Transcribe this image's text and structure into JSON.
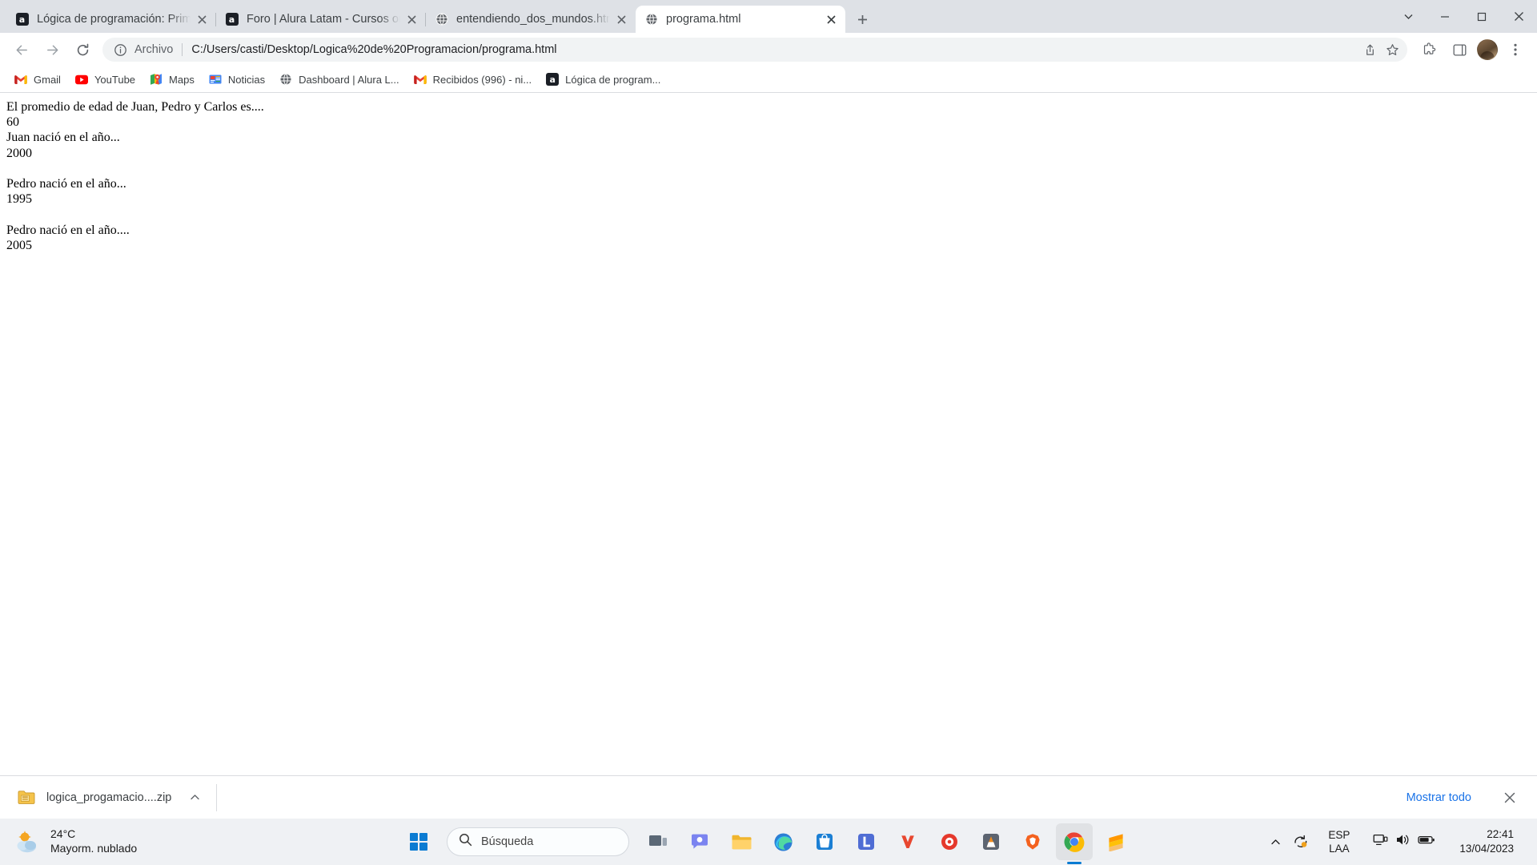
{
  "browser": {
    "tabs": [
      {
        "title": "Lógica de programación: Primero",
        "favicon": "alura-icon",
        "active": false
      },
      {
        "title": "Foro | Alura Latam - Cursos onlin",
        "favicon": "alura-icon",
        "active": false
      },
      {
        "title": "entendiendo_dos_mundos.html",
        "favicon": "globe-icon",
        "active": false
      },
      {
        "title": "programa.html",
        "favicon": "globe-icon",
        "active": true
      }
    ],
    "new_tab_label": "+",
    "window_controls": {
      "minimize": "–",
      "maximize": "□",
      "close": "✕",
      "more": "⌄"
    },
    "toolbar": {
      "back": "back-arrow-icon",
      "forward": "forward-arrow-icon",
      "reload": "reload-icon",
      "omnibox": {
        "info_icon": "info-circle-icon",
        "scheme_label": "Archivo",
        "url": "C:/Users/casti/Desktop/Logica%20de%20Programacion/programa.html"
      },
      "share_icon": "share-icon",
      "bookmark_icon": "star-icon",
      "extensions_icon": "puzzle-icon",
      "sidepanel_icon": "side-panel-icon",
      "profile_icon": "avatar-icon",
      "menu_icon": "three-dots-icon"
    },
    "bookmarks": [
      {
        "label": "Gmail",
        "icon": "gmail-icon"
      },
      {
        "label": "YouTube",
        "icon": "youtube-icon"
      },
      {
        "label": "Maps",
        "icon": "maps-icon"
      },
      {
        "label": "Noticias",
        "icon": "news-icon"
      },
      {
        "label": "Dashboard | Alura L...",
        "icon": "globe-icon"
      },
      {
        "label": "Recibidos (996) - ni...",
        "icon": "gmail-icon"
      },
      {
        "label": "Lógica de program...",
        "icon": "alura-icon"
      }
    ],
    "downloads": {
      "file_name": "logica_progamacio....zip",
      "file_icon": "zip-folder-icon",
      "caret_icon": "chevron-up-icon",
      "show_all_label": "Mostrar todo",
      "close_icon": "close-icon"
    }
  },
  "page": {
    "body_text": "El promedio de edad de Juan, Pedro y Carlos es....\n60\nJuan nació en el año...\n2000\n\nPedro nació en el año...\n1995\n\nPedro nació en el año....\n2005"
  },
  "taskbar": {
    "weather": {
      "temperature": "24°C",
      "description": "Mayorm. nublado",
      "icon": "partly-cloudy-icon"
    },
    "start_label": "start-icon",
    "search_placeholder": "Búsqueda",
    "apps": [
      {
        "name": "task-view",
        "icon": "task-view-icon"
      },
      {
        "name": "chat",
        "icon": "chat-icon"
      },
      {
        "name": "file-explorer",
        "icon": "folder-icon"
      },
      {
        "name": "edge",
        "icon": "edge-icon"
      },
      {
        "name": "microsoft-store",
        "icon": "store-icon"
      },
      {
        "name": "laragon",
        "icon": "laragon-icon"
      },
      {
        "name": "mysql-workbench",
        "icon": "workbench-icon"
      },
      {
        "name": "media-player",
        "icon": "media-icon"
      },
      {
        "name": "vlc",
        "icon": "vlc-icon"
      },
      {
        "name": "brave",
        "icon": "brave-icon"
      },
      {
        "name": "chrome",
        "icon": "chrome-icon",
        "active": true
      },
      {
        "name": "sublime-text",
        "icon": "sublime-icon"
      }
    ],
    "tray": {
      "overflow_icon": "chevron-up-icon",
      "onedrive_icon": "sync-icon",
      "language_primary": "ESP",
      "language_secondary": "LAA",
      "network_icon": "monitor-icon",
      "volume_icon": "speaker-icon",
      "battery_icon": "battery-icon",
      "time": "22:41",
      "date": "13/04/2023"
    }
  }
}
